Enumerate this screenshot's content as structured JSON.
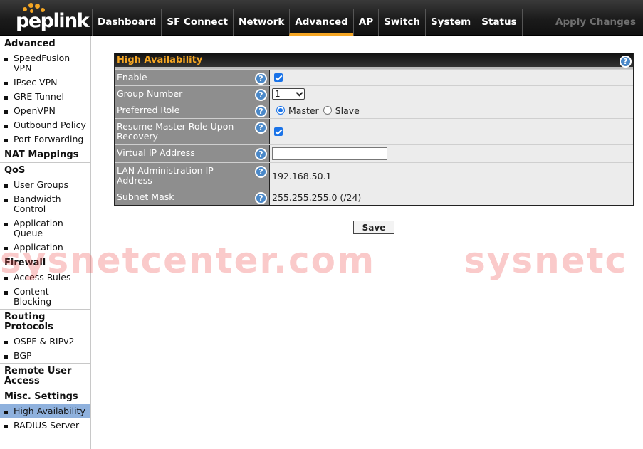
{
  "brand": {
    "logo_text": "peplink",
    "accent_color": "#f5a623"
  },
  "nav": {
    "items": [
      "Dashboard",
      "SF Connect",
      "Network",
      "Advanced",
      "AP",
      "Switch",
      "System",
      "Status"
    ],
    "active": "Advanced",
    "apply_label": "Apply Changes"
  },
  "sidebar": {
    "sections": [
      {
        "heading": "Advanced",
        "items": [
          "SpeedFusion VPN",
          "IPsec VPN",
          "GRE Tunnel",
          "OpenVPN",
          "Outbound Policy",
          "Port Forwarding"
        ]
      },
      {
        "heading": "NAT Mappings",
        "items": []
      },
      {
        "heading": "QoS",
        "items": [
          "User Groups",
          "Bandwidth Control",
          "Application Queue",
          "Application"
        ]
      },
      {
        "heading": "Firewall",
        "items": [
          "Access Rules",
          "Content Blocking"
        ]
      },
      {
        "heading": "Routing Protocols",
        "items": [
          "OSPF & RIPv2",
          "BGP"
        ]
      },
      {
        "heading": "Remote User Access",
        "items": []
      },
      {
        "heading": "Misc. Settings",
        "items": [
          "High Availability",
          "RADIUS Server"
        ]
      }
    ],
    "active_item": "High Availability"
  },
  "panel": {
    "title": "High Availability",
    "rows": {
      "enable": {
        "label": "Enable",
        "checked": true
      },
      "group_number": {
        "label": "Group Number",
        "value": "1"
      },
      "preferred_role": {
        "label": "Preferred Role",
        "options": [
          "Master",
          "Slave"
        ],
        "selected": "Master"
      },
      "resume_master": {
        "label": "Resume Master Role Upon Recovery",
        "checked": true
      },
      "virtual_ip": {
        "label": "Virtual IP Address",
        "value": ""
      },
      "lan_admin_ip": {
        "label": "LAN Administration IP Address",
        "value": "192.168.50.1"
      },
      "subnet_mask": {
        "label": "Subnet Mask",
        "value": "255.255.255.0 (/24)"
      }
    },
    "save_label": "Save"
  },
  "watermark": {
    "text_left": "sysnetcenter.com",
    "text_right": "sysnetc"
  }
}
